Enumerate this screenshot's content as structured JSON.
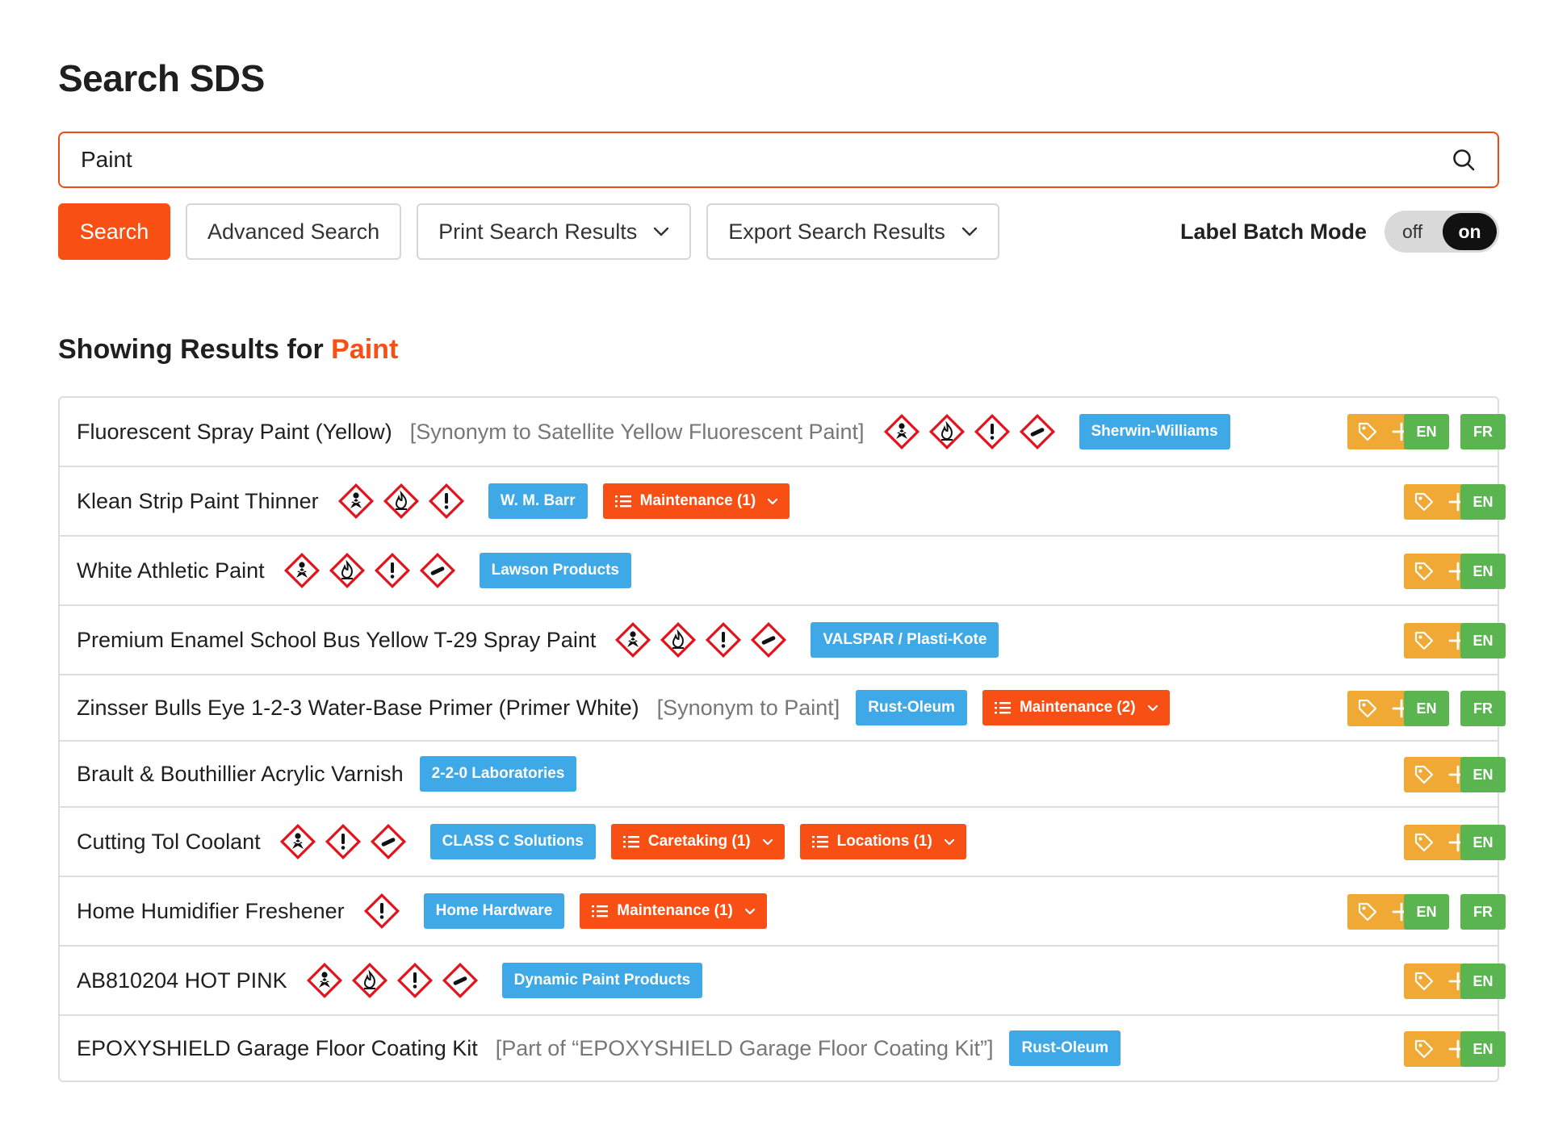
{
  "page": {
    "title": "Search SDS"
  },
  "search": {
    "value": "Paint"
  },
  "toolbar": {
    "search_label": "Search",
    "advanced_label": "Advanced Search",
    "print_label": "Print Search Results",
    "export_label": "Export Search Results",
    "batch_label": "Label Batch Mode",
    "toggle_off": "off",
    "toggle_on": "on"
  },
  "results_heading": {
    "prefix": "Showing Results for",
    "term": "Paint"
  },
  "colors": {
    "accent": "#f74f14",
    "supplier": "#3fa8e6",
    "tag": "#f0a935",
    "lang": "#5ab550",
    "hazard": "#e3131b"
  },
  "results": [
    {
      "name": "Fluorescent Spray Paint (Yellow)",
      "synonym": "[Synonym to Satellite Yellow Fluorescent Paint]",
      "pictograms": [
        "health-hazard",
        "flame",
        "exclamation",
        "gas-cylinder"
      ],
      "supplier": "Sherwin-Williams",
      "dropdowns": [],
      "languages": [
        "EN",
        "FR"
      ]
    },
    {
      "name": "Klean Strip Paint Thinner",
      "synonym": "",
      "pictograms": [
        "health-hazard",
        "flame",
        "exclamation"
      ],
      "supplier": "W. M. Barr",
      "dropdowns": [
        "Maintenance (1)"
      ],
      "languages": [
        "EN"
      ]
    },
    {
      "name": "White Athletic Paint",
      "synonym": "",
      "pictograms": [
        "health-hazard",
        "flame",
        "exclamation",
        "gas-cylinder"
      ],
      "supplier": "Lawson Products",
      "dropdowns": [],
      "languages": [
        "EN"
      ]
    },
    {
      "name": "Premium Enamel School Bus Yellow T-29 Spray Paint",
      "synonym": "",
      "pictograms": [
        "health-hazard",
        "flame",
        "exclamation",
        "gas-cylinder"
      ],
      "supplier": "VALSPAR / Plasti-Kote",
      "dropdowns": [],
      "languages": [
        "EN"
      ]
    },
    {
      "name": "Zinsser Bulls Eye 1-2-3 Water-Base Primer (Primer White)",
      "synonym": "[Synonym to Paint]",
      "pictograms": [],
      "supplier": "Rust-Oleum",
      "dropdowns": [
        "Maintenance (2)"
      ],
      "languages": [
        "EN",
        "FR"
      ]
    },
    {
      "name": "Brault & Bouthillier Acrylic Varnish",
      "synonym": "",
      "pictograms": [],
      "supplier": "2-2-0 Laboratories",
      "dropdowns": [],
      "languages": [
        "EN"
      ]
    },
    {
      "name": "Cutting Tol Coolant",
      "synonym": "",
      "pictograms": [
        "health-hazard",
        "exclamation",
        "gas-cylinder"
      ],
      "supplier": "CLASS C Solutions",
      "dropdowns": [
        "Caretaking (1)",
        "Locations (1)"
      ],
      "languages": [
        "EN"
      ]
    },
    {
      "name": "Home Humidifier Freshener",
      "synonym": "",
      "pictograms": [
        "exclamation"
      ],
      "supplier": "Home Hardware",
      "dropdowns": [
        "Maintenance (1)"
      ],
      "languages": [
        "EN",
        "FR"
      ]
    },
    {
      "name": "AB810204 HOT PINK",
      "synonym": "",
      "pictograms": [
        "health-hazard",
        "flame",
        "exclamation",
        "gas-cylinder"
      ],
      "supplier": "Dynamic Paint Products",
      "dropdowns": [],
      "languages": [
        "EN"
      ]
    },
    {
      "name": "EPOXYSHIELD Garage Floor Coating Kit",
      "synonym": "[Part of “EPOXYSHIELD Garage Floor Coating Kit”]",
      "pictograms": [],
      "supplier": "Rust-Oleum",
      "dropdowns": [],
      "languages": [
        "EN"
      ]
    }
  ]
}
